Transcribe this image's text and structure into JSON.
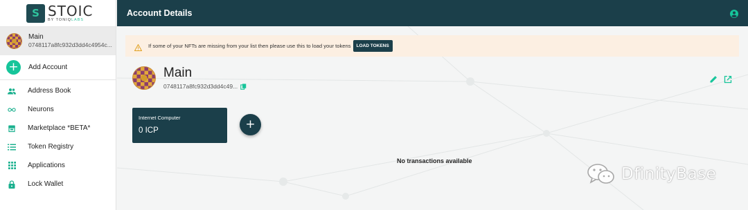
{
  "logo": {
    "title": "STOIC",
    "byline_prefix": "BY ",
    "byline_brand": "TONIQ",
    "byline_suffix": "LABS",
    "mark": "S"
  },
  "sidebar": {
    "account": {
      "name": "Main",
      "address": "0748117a8fc932d3dd4c4954c..."
    },
    "add_account": {
      "icon": "+",
      "label": "Add Account"
    },
    "items": [
      {
        "label": "Address Book",
        "icon": "people-icon"
      },
      {
        "label": "Neurons",
        "icon": "infinity-icon"
      },
      {
        "label": "Marketplace *BETA*",
        "icon": "store-icon"
      },
      {
        "label": "Token Registry",
        "icon": "list-icon"
      },
      {
        "label": "Applications",
        "icon": "apps-grid-icon"
      },
      {
        "label": "Lock Wallet",
        "icon": "lock-icon"
      }
    ]
  },
  "header": {
    "title": "Account Details"
  },
  "banner": {
    "text": "If some of your NFTs are missing from your list then please use this to load your tokens",
    "button": "LOAD TOKENS"
  },
  "profile": {
    "name": "Main",
    "address": "0748117a8fc932d3dd4c49..."
  },
  "token_card": {
    "name": "Internet Computer",
    "balance": "0 ICP"
  },
  "fab": {
    "icon": "+"
  },
  "transactions": {
    "empty_text": "No transactions available"
  },
  "watermark": {
    "text": "DfinityBase"
  },
  "colors": {
    "primary": "#1b3f4a",
    "accent": "#16c59a",
    "banner_bg": "#fcefe2",
    "warning": "#e0a020"
  }
}
